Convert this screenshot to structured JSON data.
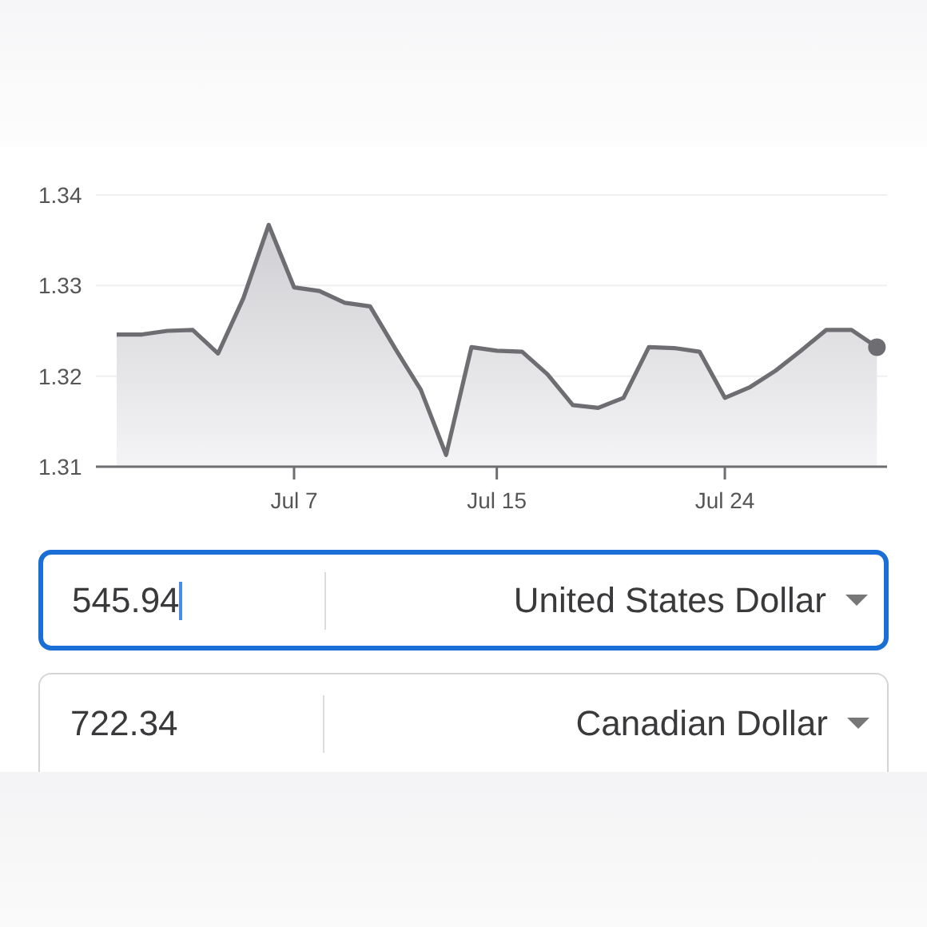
{
  "chart_data": {
    "type": "area",
    "categories": [
      null,
      null,
      null,
      null,
      null,
      null,
      null,
      "Jul 7",
      null,
      null,
      null,
      null,
      null,
      null,
      null,
      "Jul 15",
      null,
      null,
      null,
      null,
      null,
      null,
      null,
      null,
      "Jul 24",
      null,
      null,
      null,
      null,
      null,
      null
    ],
    "series": [
      {
        "color": "#6d6d72",
        "values": [
          1.3246,
          1.3246,
          1.325,
          1.3251,
          1.3225,
          1.3286,
          1.3367,
          1.3298,
          1.3294,
          1.3281,
          1.3277,
          1.323,
          1.3185,
          1.3113,
          1.3232,
          1.3228,
          1.3227,
          1.3202,
          1.3168,
          1.3165,
          1.3176,
          1.3232,
          1.3231,
          1.3227,
          1.3176,
          1.3188,
          1.3206,
          1.3228,
          1.3251,
          1.3251,
          1.3232
        ]
      }
    ],
    "ylim": [
      1.31,
      1.34
    ],
    "yticks": [
      {
        "value": 1.31,
        "label": "1.31"
      },
      {
        "value": 1.32,
        "label": "1.32"
      },
      {
        "value": 1.33,
        "label": "1.33"
      },
      {
        "value": 1.34,
        "label": "1.34"
      }
    ]
  },
  "converter": [
    {
      "amount": "545.94",
      "currency": "United States Dollar",
      "focused": true
    },
    {
      "amount": "722.34",
      "currency": "Canadian Dollar",
      "focused": false
    }
  ]
}
